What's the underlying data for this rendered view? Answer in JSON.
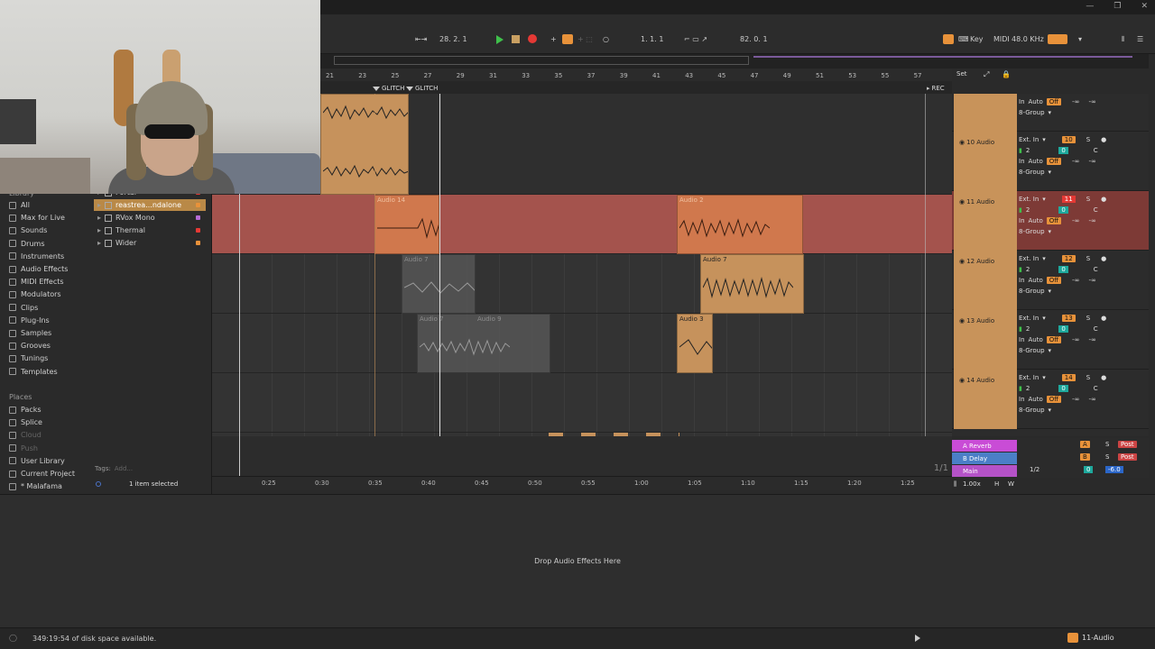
{
  "transport": {
    "tempo_pos": "28.  2.  1",
    "arrangement_pos": "1.  1.  1",
    "loop_len": "82.  0.  1",
    "key_label": "Key",
    "midi_label": "MIDI",
    "sample_rate": "48.0 KHz"
  },
  "ruler": {
    "bars": [
      "21",
      "23",
      "25",
      "27",
      "29",
      "31",
      "33",
      "35",
      "37",
      "39",
      "41",
      "43",
      "45",
      "47",
      "49",
      "51",
      "53",
      "55",
      "57"
    ],
    "set_label": "Set"
  },
  "locators": {
    "glitch1": "GLITCH",
    "glitch2": "GLITCH",
    "rec": "REC"
  },
  "browser": {
    "library_title": "Library",
    "categories": [
      "All",
      "Max for Live",
      "Sounds",
      "Drums",
      "Instruments",
      "Audio Effects",
      "MIDI Effects",
      "Modulators",
      "Clips",
      "Plug-Ins",
      "Samples",
      "Grooves",
      "Tunings",
      "Templates"
    ],
    "places_title": "Places",
    "places": [
      "Packs",
      "Splice",
      "Cloud",
      "Push",
      "User Library",
      "Current Project",
      "* Malafama"
    ],
    "items": [
      "Portal",
      "reastrea...ndalone",
      "RVox Mono",
      "Thermal",
      "Wider"
    ],
    "tags_label": "Tags:",
    "tags_placeholder": "Add...",
    "selection_status": "1 item selected"
  },
  "clips": {
    "a14": "Audio 14",
    "a2": "Audio 2",
    "a7a": "Audio 7",
    "a7b": "Audio 7",
    "a7c": "Audio 7",
    "a9": "Audio 9",
    "a3": "Audio 3"
  },
  "tracks": [
    {
      "name": "10 Audio",
      "input": "Ext. In",
      "ch": "2",
      "num": "10"
    },
    {
      "name": "11 Audio",
      "input": "Ext. In",
      "ch": "2",
      "num": "11"
    },
    {
      "name": "12 Audio",
      "input": "Ext. In",
      "ch": "2",
      "num": "12"
    },
    {
      "name": "13 Audio",
      "input": "Ext. In",
      "ch": "2",
      "num": "13"
    },
    {
      "name": "14 Audio",
      "input": "Ext. In",
      "ch": "2",
      "num": "14"
    }
  ],
  "track_labels": {
    "monitor_in": "In",
    "monitor_auto": "Auto",
    "monitor_off": "Off",
    "group": "8-Group",
    "inf": "-∞",
    "solo": "S",
    "center": "C",
    "zero": "0"
  },
  "returns": {
    "reverb": "A Reverb",
    "delay": "B Delay",
    "main": "Main",
    "reverb_letter": "A",
    "delay_letter": "B",
    "post": "Post",
    "ratio": "1/2",
    "main_vol": "-6.0",
    "page": "1/1",
    "zoom": "1.00x",
    "h": "H",
    "w": "W"
  },
  "timeline": [
    "0:25",
    "0:30",
    "0:35",
    "0:40",
    "0:45",
    "0:50",
    "0:55",
    "1:00",
    "1:05",
    "1:10",
    "1:15",
    "1:20",
    "1:25"
  ],
  "device": {
    "drop_text": "Drop Audio Effects Here"
  },
  "status": {
    "message": "349:19:54 of disk space available.",
    "track": "11-Audio"
  }
}
